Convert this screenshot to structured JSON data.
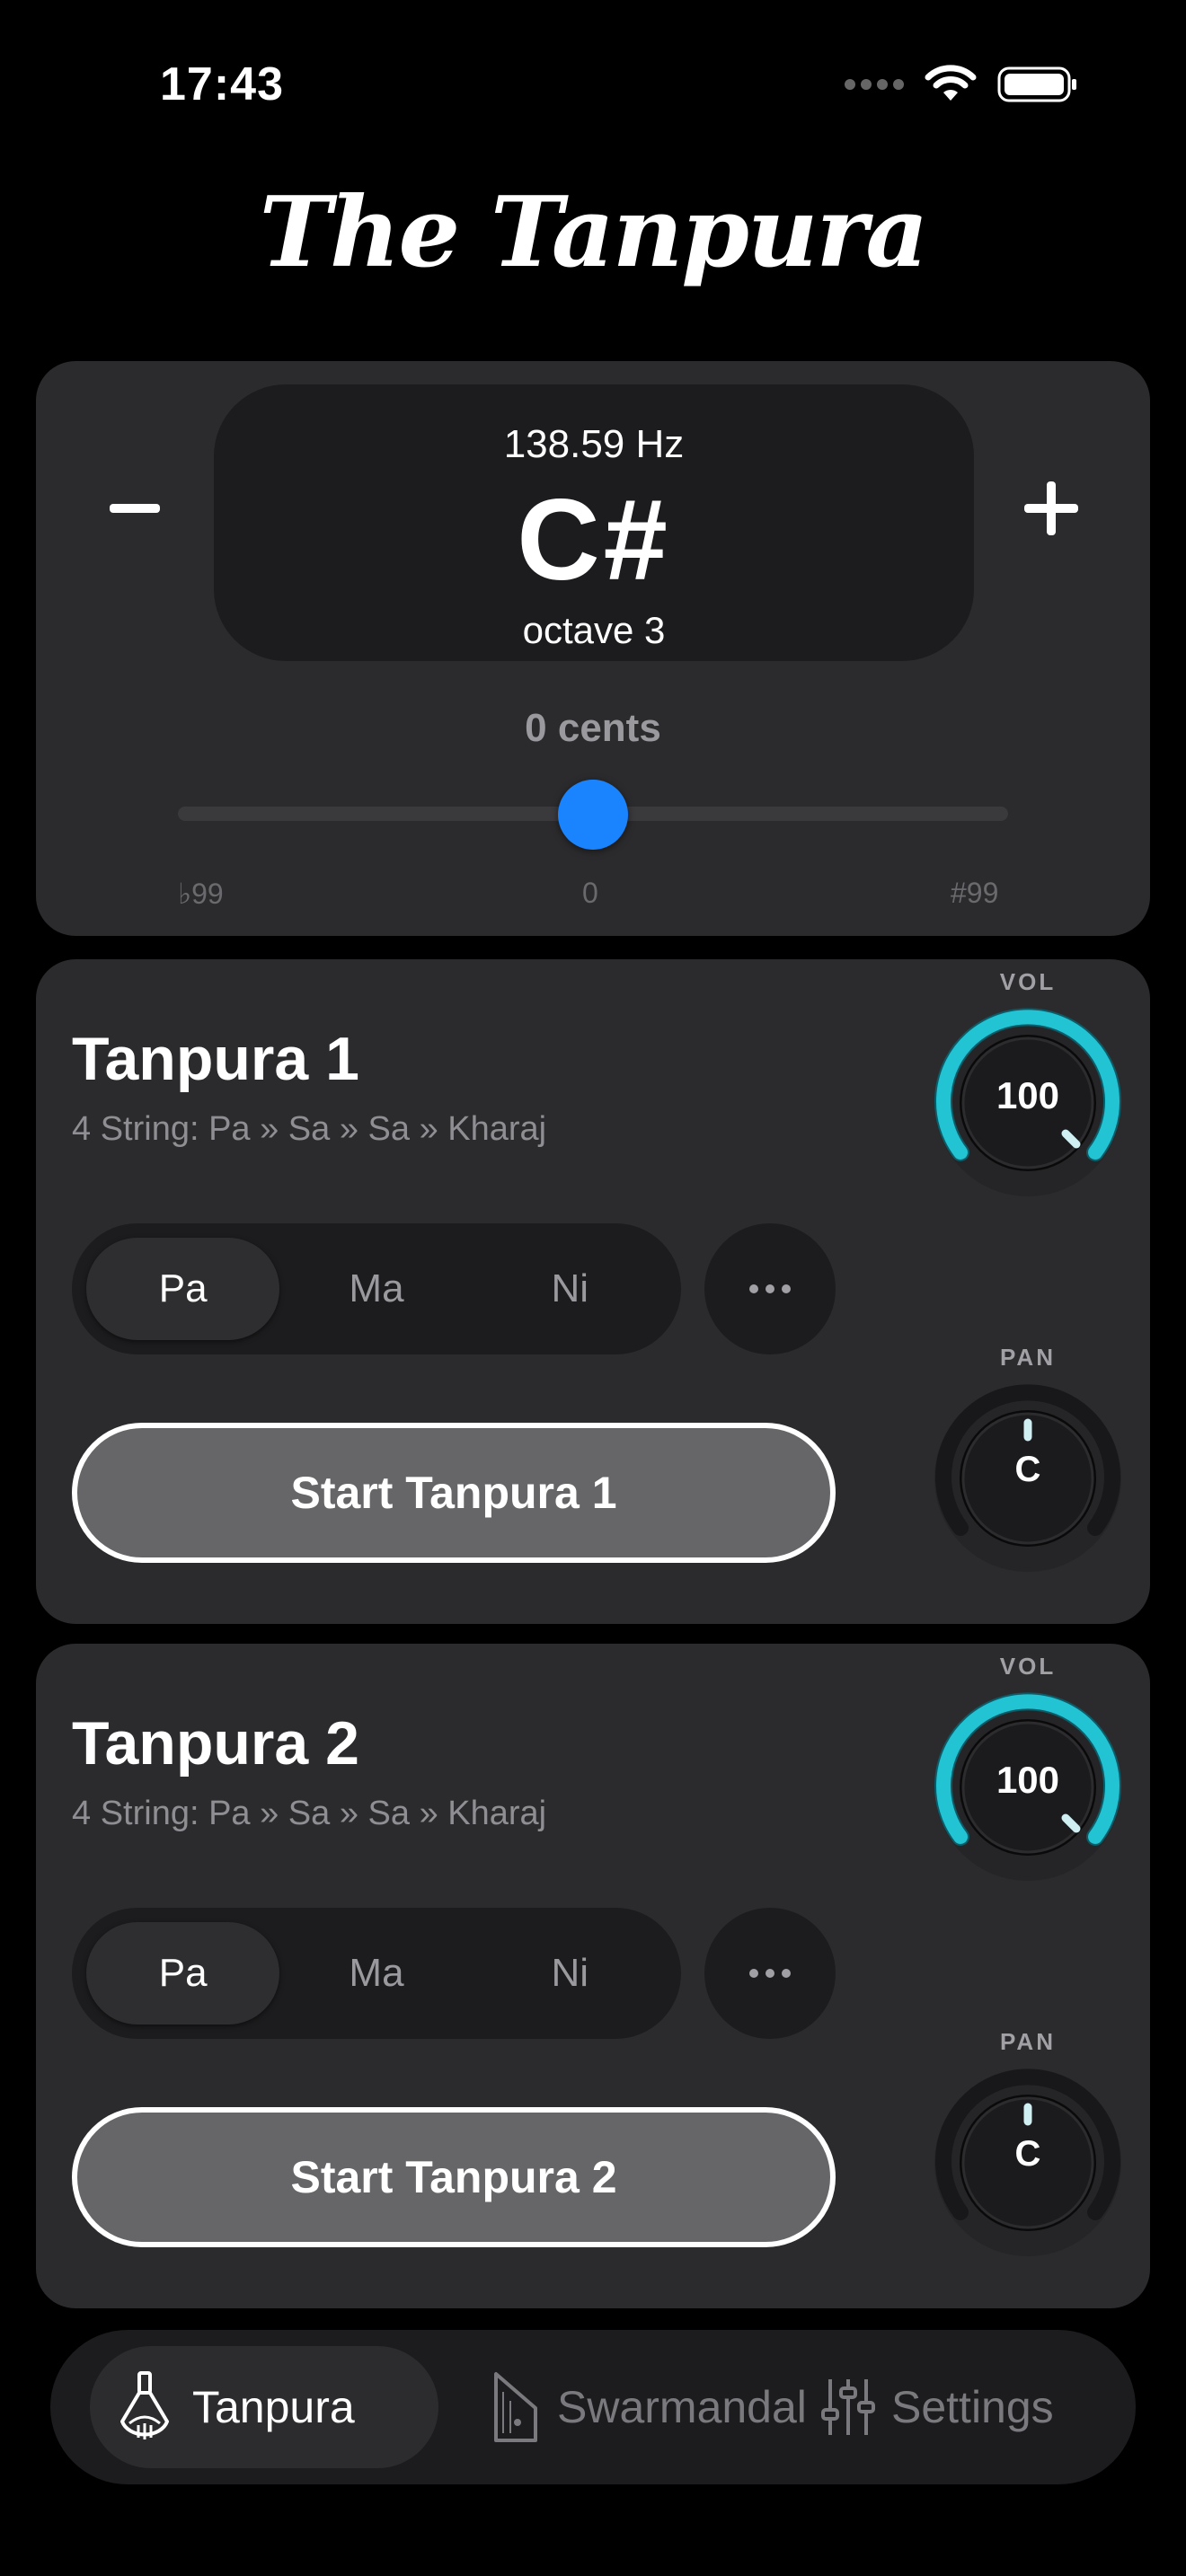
{
  "status_bar": {
    "time": "17:43"
  },
  "app": {
    "title": "The Tanpura"
  },
  "pitch": {
    "frequency": "138.59 Hz",
    "note": "C#",
    "octave": "octave 3",
    "cents_label": "0 cents",
    "cents_value": 0,
    "cents_min_label": "♭99",
    "cents_mid_label": "0",
    "cents_max_label": "#99",
    "cents_range": [
      -99,
      99
    ]
  },
  "tanpuras": [
    {
      "title": "Tanpura 1",
      "subtitle": "4 String: Pa » Sa » Sa » Kharaj",
      "options": [
        "Pa",
        "Ma",
        "Ni"
      ],
      "selected": "Pa",
      "start_label": "Start Tanpura 1",
      "vol_label": "VOL",
      "vol_value": "100",
      "pan_label": "PAN",
      "pan_value": "C"
    },
    {
      "title": "Tanpura 2",
      "subtitle": "4 String: Pa » Sa » Sa » Kharaj",
      "options": [
        "Pa",
        "Ma",
        "Ni"
      ],
      "selected": "Pa",
      "start_label": "Start Tanpura 2",
      "vol_label": "VOL",
      "vol_value": "100",
      "pan_label": "PAN",
      "pan_value": "C"
    }
  ],
  "tabbar": {
    "tabs": [
      {
        "label": "Tanpura",
        "icon": "tanpura-icon",
        "active": true
      },
      {
        "label": "Swarmandal",
        "icon": "swarmandal-icon",
        "active": false
      },
      {
        "label": "Settings",
        "icon": "sliders-icon",
        "active": false
      }
    ]
  },
  "colors": {
    "accent_blue": "#1a84ff",
    "knob_teal": "#22c3d3",
    "card_bg": "#2b2b2d"
  }
}
